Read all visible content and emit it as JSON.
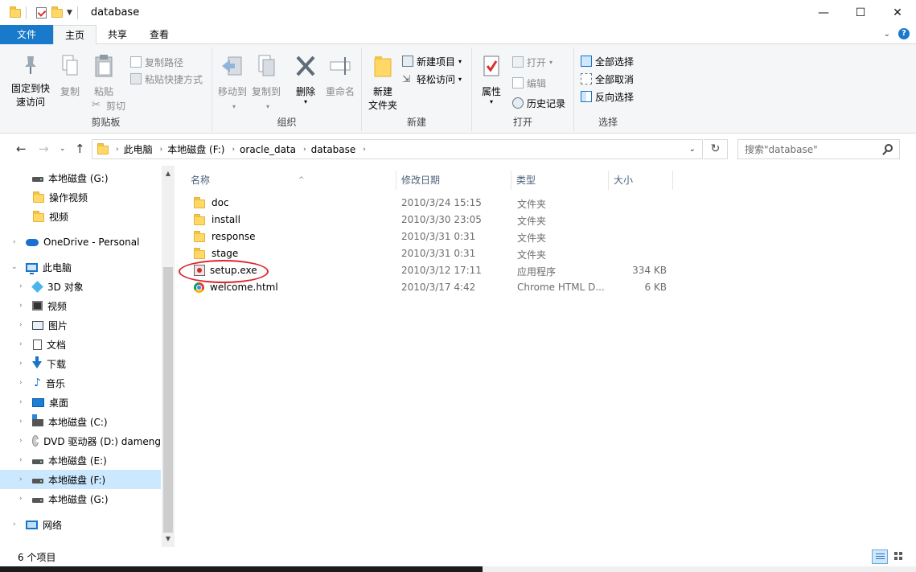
{
  "window": {
    "title": "database",
    "minimize": "—",
    "maximize": "☐",
    "close": "✕"
  },
  "tabs": [
    {
      "label": "文件"
    },
    {
      "label": "主页"
    },
    {
      "label": "共享"
    },
    {
      "label": "查看"
    }
  ],
  "ribbon": {
    "clipboard": {
      "label": "剪贴板",
      "pin": "固定到快",
      "pin2": "速访问",
      "copy": "复制",
      "paste": "粘贴",
      "copy_path": "复制路径",
      "paste_shortcut": "粘贴快捷方式",
      "cut": "剪切"
    },
    "organize": {
      "label": "组织",
      "move_to": "移动到",
      "copy_to": "复制到",
      "delete": "删除",
      "rename": "重命名"
    },
    "new": {
      "label": "新建",
      "new_folder": "新建",
      "new_folder2": "文件夹",
      "new_item": "新建项目",
      "easy_access": "轻松访问"
    },
    "open": {
      "label": "打开",
      "properties": "属性",
      "open": "打开",
      "edit": "编辑",
      "history": "历史记录"
    },
    "select": {
      "label": "选择",
      "select_all": "全部选择",
      "select_none": "全部取消",
      "invert": "反向选择"
    }
  },
  "address": {
    "crumbs": [
      "此电脑",
      "本地磁盘 (F:)",
      "oracle_data",
      "database"
    ],
    "search_placeholder": "搜索\"database\""
  },
  "nav": [
    {
      "label": "本地磁盘 (G:)",
      "icon": "drive-icon"
    },
    {
      "label": "操作视频",
      "icon": "folder-icon"
    },
    {
      "label": "视频",
      "icon": "folder-icon"
    },
    {
      "label": "OneDrive - Personal",
      "icon": "onedrive-icon"
    },
    {
      "label": "此电脑",
      "icon": "pc-icon"
    },
    {
      "label": "3D 对象",
      "icon": "3d-objects-icon"
    },
    {
      "label": "视频",
      "icon": "videos-icon"
    },
    {
      "label": "图片",
      "icon": "pictures-icon"
    },
    {
      "label": "文档",
      "icon": "documents-icon"
    },
    {
      "label": "下载",
      "icon": "downloads-icon"
    },
    {
      "label": "音乐",
      "icon": "music-icon"
    },
    {
      "label": "桌面",
      "icon": "desktop-icon"
    },
    {
      "label": "本地磁盘 (C:)",
      "icon": "system-drive-icon"
    },
    {
      "label": "DVD 驱动器 (D:) dameng",
      "icon": "dvd-icon"
    },
    {
      "label": "本地磁盘 (E:)",
      "icon": "drive-icon"
    },
    {
      "label": "本地磁盘 (F:)",
      "icon": "drive-icon"
    },
    {
      "label": "本地磁盘 (G:)",
      "icon": "drive-icon"
    },
    {
      "label": "网络",
      "icon": "network-icon"
    }
  ],
  "columns": {
    "name": "名称",
    "modified": "修改日期",
    "type": "类型",
    "size": "大小"
  },
  "files": [
    {
      "name": "doc",
      "modified": "2010/3/24 15:15",
      "type": "文件夹",
      "size": "",
      "icon": "folder-icon"
    },
    {
      "name": "install",
      "modified": "2010/3/30 23:05",
      "type": "文件夹",
      "size": "",
      "icon": "folder-icon"
    },
    {
      "name": "response",
      "modified": "2010/3/31 0:31",
      "type": "文件夹",
      "size": "",
      "icon": "folder-icon"
    },
    {
      "name": "stage",
      "modified": "2010/3/31 0:31",
      "type": "文件夹",
      "size": "",
      "icon": "folder-icon"
    },
    {
      "name": "setup.exe",
      "modified": "2010/3/12 17:11",
      "type": "应用程序",
      "size": "334 KB",
      "icon": "exe-icon"
    },
    {
      "name": "welcome.html",
      "modified": "2010/3/17 4:42",
      "type": "Chrome HTML D...",
      "size": "6 KB",
      "icon": "chrome-html-icon"
    }
  ],
  "status": {
    "count": "6 个项目"
  },
  "colors": {
    "accent": "#1979ca",
    "selection": "#cce8ff",
    "highlight_ring": "#e0252a"
  }
}
